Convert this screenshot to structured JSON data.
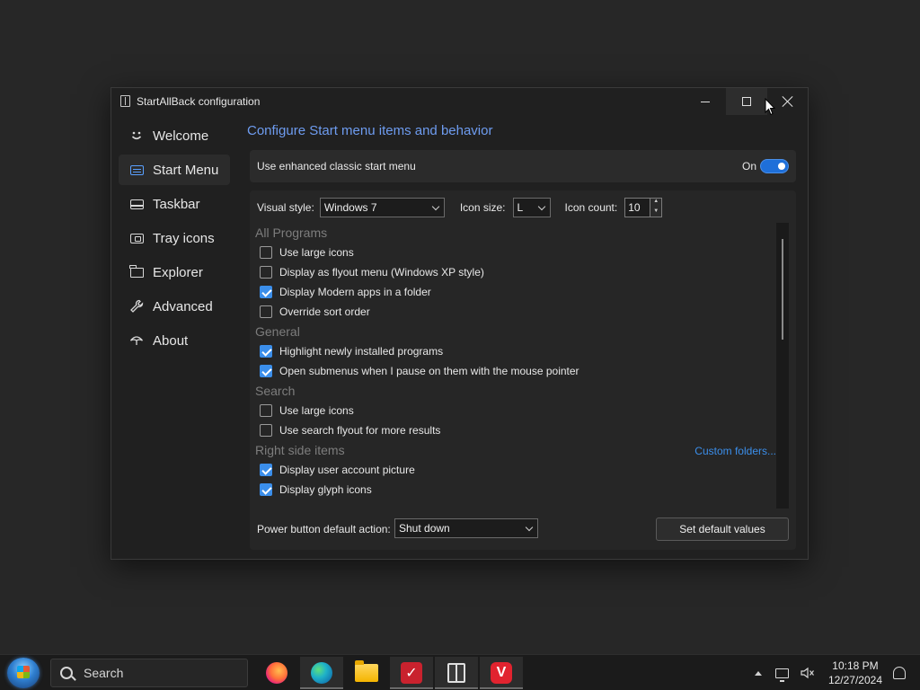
{
  "window": {
    "title": "StartAllBack configuration"
  },
  "sidebar": {
    "items": [
      {
        "label": "Welcome",
        "icon": "smiley-icon"
      },
      {
        "label": "Start Menu",
        "icon": "start-menu-icon",
        "active": true
      },
      {
        "label": "Taskbar",
        "icon": "taskbar-icon"
      },
      {
        "label": "Tray icons",
        "icon": "tray-icon"
      },
      {
        "label": "Explorer",
        "icon": "folder-icon"
      },
      {
        "label": "Advanced",
        "icon": "wrench-icon"
      },
      {
        "label": "About",
        "icon": "umbrella-icon"
      }
    ]
  },
  "content": {
    "title": "Configure Start menu items and behavior",
    "enhanced_menu": {
      "label": "Use enhanced classic start menu",
      "state": "On",
      "checked": true
    },
    "visual_style": {
      "label": "Visual style:",
      "value": "Windows 7"
    },
    "icon_size": {
      "label": "Icon size:",
      "value": "L"
    },
    "icon_count": {
      "label": "Icon count:",
      "value": "10"
    },
    "sections": [
      {
        "title": "All Programs",
        "items": [
          {
            "label": "Use large icons",
            "checked": false
          },
          {
            "label": "Display as flyout menu (Windows XP style)",
            "checked": false
          },
          {
            "label": "Display Modern apps in a folder",
            "checked": true
          },
          {
            "label": "Override sort order",
            "checked": false
          }
        ]
      },
      {
        "title": "General",
        "items": [
          {
            "label": "Highlight newly installed programs",
            "checked": true
          },
          {
            "label": "Open submenus when I pause on them with the mouse pointer",
            "checked": true
          }
        ]
      },
      {
        "title": "Search",
        "items": [
          {
            "label": "Use large icons",
            "checked": false
          },
          {
            "label": "Use search flyout for more results",
            "checked": false
          }
        ]
      },
      {
        "title": "Right side items",
        "link": "Custom folders...",
        "items": [
          {
            "label": "Display user account picture",
            "checked": true
          },
          {
            "label": "Display glyph icons",
            "checked": true
          }
        ]
      }
    ],
    "power": {
      "label": "Power button default action:",
      "value": "Shut down"
    },
    "default_button": "Set default values"
  },
  "taskbar": {
    "search_placeholder": "Search",
    "apps": [
      "firefox-icon",
      "edge-icon",
      "file-explorer-icon",
      "vivaldi-icon",
      "startallback-icon",
      "vivaldi-icon"
    ],
    "time": "10:18 PM",
    "date": "12/27/2024"
  },
  "colors": {
    "accent": "#3b8eea",
    "title_accent": "#6e9cf0",
    "window_bg": "#202020",
    "desktop_bg": "#272727"
  }
}
